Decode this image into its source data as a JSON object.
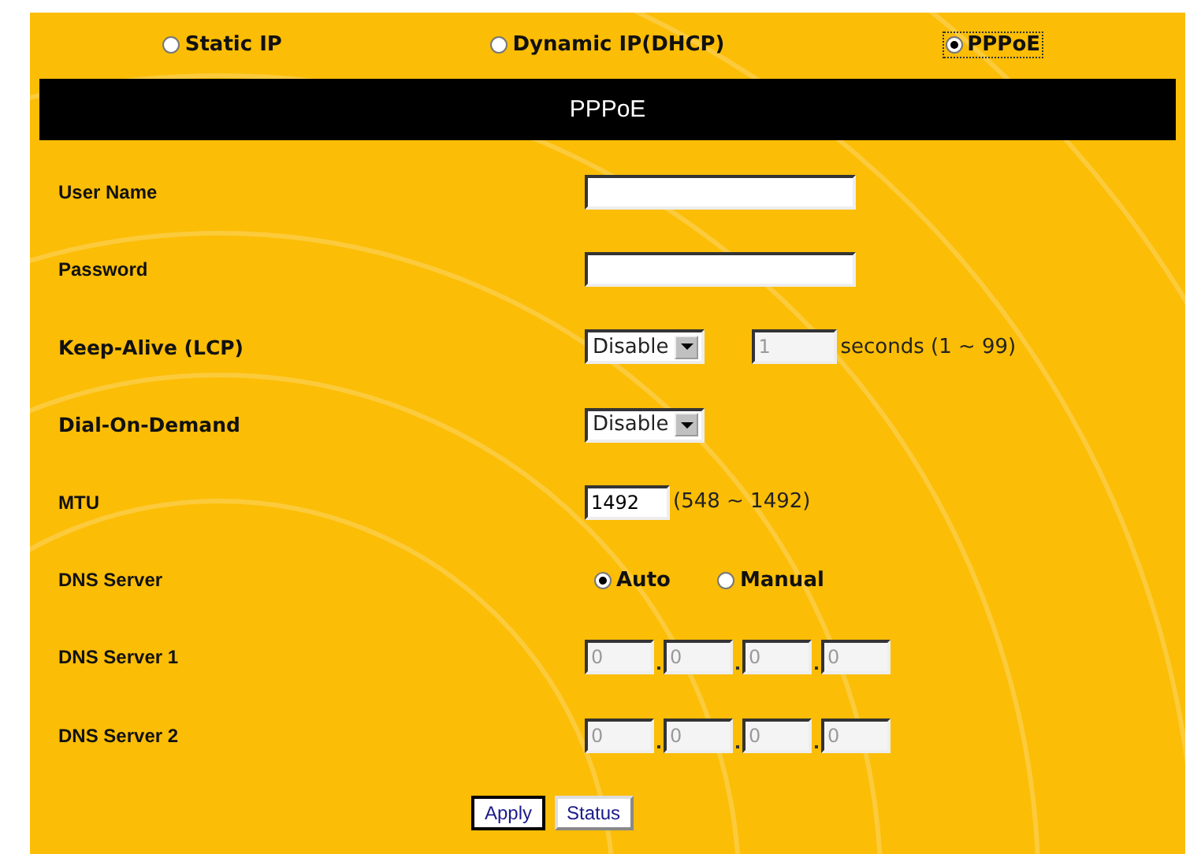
{
  "connection_types": [
    {
      "label": "Static IP",
      "selected": false
    },
    {
      "label": "Dynamic IP(DHCP)",
      "selected": false
    },
    {
      "label": "PPPoE",
      "selected": true
    }
  ],
  "section_title": "PPPoE",
  "fields": [
    {
      "kind": "text",
      "label": "User Name"
    },
    {
      "kind": "text",
      "label": "Password"
    },
    {
      "kind": "select_number",
      "label": "Keep-Alive (LCP)",
      "select": "Disable",
      "number": "1",
      "disabled": true,
      "hint": "seconds (1 ~ 99)"
    },
    {
      "kind": "select",
      "label": "Dial-On-Demand",
      "select": "Disable"
    },
    {
      "kind": "number",
      "label": "MTU",
      "value": "1492",
      "hint": "(548 ~ 1492)"
    },
    {
      "kind": "radios",
      "label": "DNS Server",
      "options": [
        {
          "label": "Auto",
          "selected": true
        },
        {
          "label": "Manual",
          "selected": false
        }
      ]
    },
    {
      "kind": "ip",
      "label": "DNS Server 1",
      "octets": [
        "0",
        "0",
        "0",
        "0"
      ],
      "disabled": true
    },
    {
      "kind": "ip",
      "label": "DNS Server 2",
      "octets": [
        "0",
        "0",
        "0",
        "0"
      ],
      "disabled": true
    }
  ],
  "buttons": [
    "Apply",
    "Status"
  ]
}
